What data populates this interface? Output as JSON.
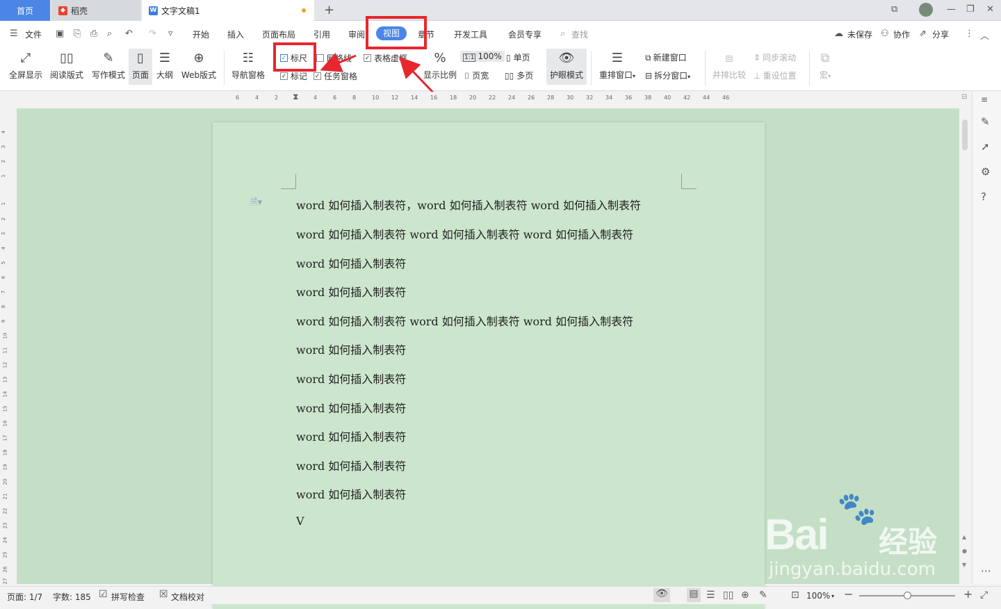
{
  "tabs": {
    "home": "首页",
    "daoke": "稻壳",
    "doc": "文字文稿1"
  },
  "menubar": {
    "file": "文件",
    "tabs": [
      "开始",
      "插入",
      "页面布局",
      "引用",
      "审阅",
      "视图",
      "章节",
      "开发工具",
      "会员专享"
    ],
    "active_tab": "视图",
    "search": "查找",
    "unsaved": "未保存",
    "collab": "协作",
    "share": "分享"
  },
  "ribbon": {
    "fullscreen": "全屏显示",
    "reading": "阅读版式",
    "writing": "写作模式",
    "page": "页面",
    "outline": "大纲",
    "web": "Web版式",
    "nav_pane": "导航窗格",
    "ruler": "标尺",
    "gridlines": "网格线",
    "table_gridlines": "表格虚框",
    "marks": "标记",
    "task_pane": "任务窗格",
    "zoom": "显示比例",
    "zoom_100": "100%",
    "single_page": "单页",
    "page_width": "页宽",
    "multi_page": "多页",
    "eye_mode": "护眼模式",
    "rearrange": "重排窗口",
    "new_window": "新建窗口",
    "split_window": "拆分窗口",
    "side_by_side": "并排比较",
    "sync_scroll": "同步滚动",
    "reset_position": "重设位置",
    "macro": "宏"
  },
  "ruler_ticks": [
    "6",
    "4",
    "2",
    "2",
    "4",
    "6",
    "8",
    "10",
    "12",
    "14",
    "16",
    "18",
    "20",
    "22",
    "24",
    "26",
    "28",
    "30",
    "32",
    "34",
    "36",
    "38",
    "40",
    "42",
    "44",
    "46"
  ],
  "vruler_ticks": [
    "4",
    "3",
    "2",
    "1",
    "1",
    "2",
    "3",
    "4",
    "5",
    "6",
    "7",
    "8",
    "9",
    "10",
    "11",
    "12",
    "13",
    "14",
    "15",
    "16",
    "17",
    "18",
    "19",
    "20",
    "21",
    "22",
    "23",
    "24",
    "25",
    "26",
    "27"
  ],
  "document": {
    "lines": [
      "word 如何插入制表符，word 如何插入制表符 word 如何插入制表符",
      "word 如何插入制表符 word 如何插入制表符 word 如何插入制表符",
      "word 如何插入制表符",
      "word 如何插入制表符",
      "word 如何插入制表符 word 如何插入制表符 word 如何插入制表符",
      "word 如何插入制表符",
      "word 如何插入制表符",
      "word 如何插入制表符",
      "word 如何插入制表符",
      "word 如何插入制表符",
      "word 如何插入制表符",
      "V"
    ]
  },
  "status": {
    "page": "页面: 1/7",
    "words": "字数: 185",
    "spell": "拼写检查",
    "proof": "文档校对",
    "zoom": "100%"
  },
  "watermark": {
    "brand": "Bai",
    "brand2": "经验",
    "url": "jingyan.baidu.com"
  },
  "colors": {
    "accent": "#4b86e6",
    "highlight": "#e8262e",
    "eye_bg": "#c5dfc7",
    "page_bg": "#cce6cd"
  }
}
